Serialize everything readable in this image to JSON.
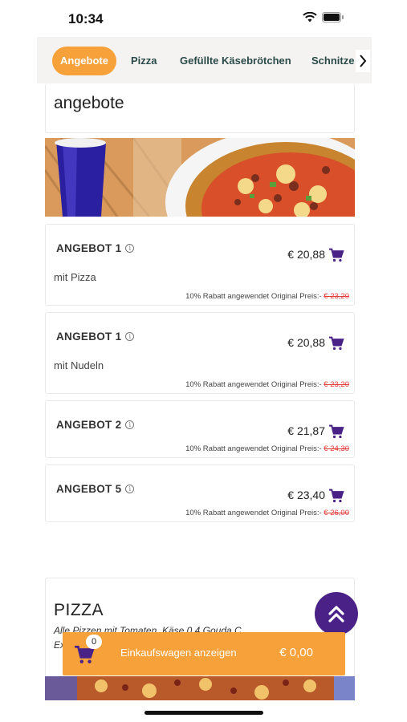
{
  "status_bar": {
    "time": "10:34"
  },
  "tabs": [
    {
      "label": "Angebote",
      "active": true
    },
    {
      "label": "Pizza",
      "active": false
    },
    {
      "label": "Gefüllte Käsebrötchen",
      "active": false
    },
    {
      "label": "Schnitze",
      "active": false
    }
  ],
  "section": {
    "title": "angebote"
  },
  "items": [
    {
      "name": "ANGEBOT 1",
      "description": "mit Pizza",
      "price": "€ 20,88",
      "discount_text": "10% Rabatt angewendet Original Preis:-",
      "original_price": "€ 23,20"
    },
    {
      "name": "ANGEBOT 1",
      "description": "mit Nudeln",
      "price": "€ 20,88",
      "discount_text": "10% Rabatt angewendet Original Preis:-",
      "original_price": "€ 23,20"
    },
    {
      "name": "ANGEBOT 2",
      "description": "",
      "price": "€ 21,87",
      "discount_text": "10% Rabatt angewendet Original Preis:-",
      "original_price": "€ 24,30"
    },
    {
      "name": "ANGEBOT 5",
      "description": "",
      "price": "€ 23,40",
      "discount_text": "10% Rabatt angewendet Original Preis:-",
      "original_price": "€ 26,00"
    }
  ],
  "pizza_section": {
    "title": "PIZZA",
    "description": "Alle Pizzen mit Tomaten, Käse 0,4 Gouda C...",
    "description_line2": "Ex..."
  },
  "cart": {
    "count": "0",
    "label": "Einkaufswagen anzeigen",
    "total": "€ 0,00"
  },
  "colors": {
    "accent": "#f7a13a",
    "brand_purple": "#4a2287",
    "strike": "#e53935"
  },
  "icons": {
    "cart": "cart-icon",
    "info": "info-icon",
    "scroll_top": "double-chevron-up-icon",
    "next": "chevron-right-icon"
  }
}
